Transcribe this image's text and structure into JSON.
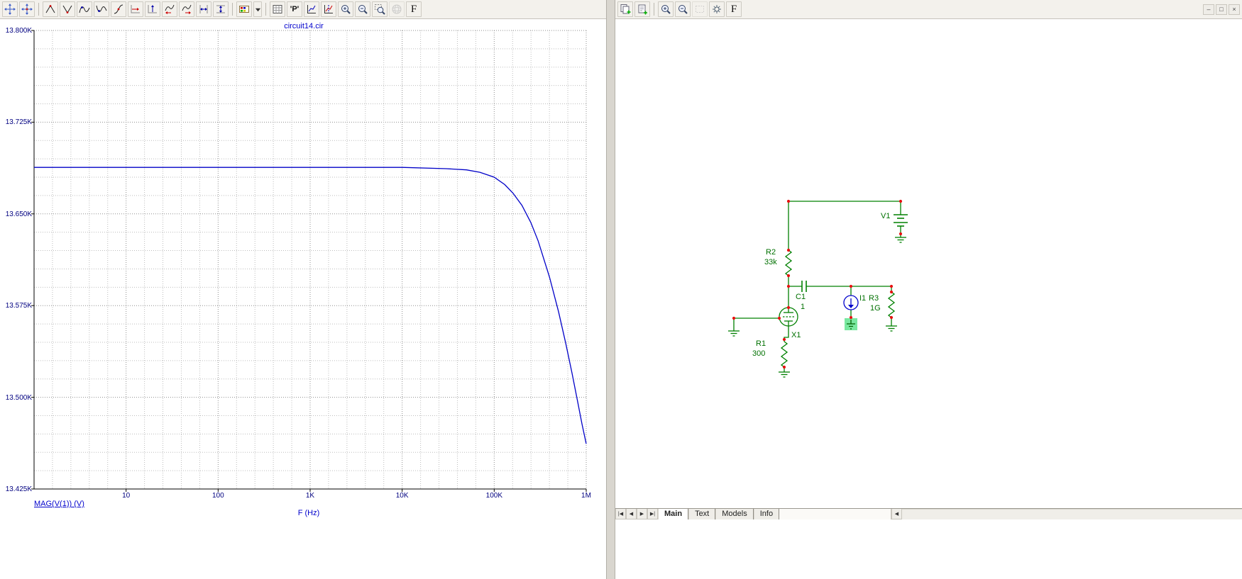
{
  "app": {
    "background": "#ffffff"
  },
  "chart_data": {
    "type": "line",
    "title": "circuit14.cir",
    "xlabel": "F (Hz)",
    "ylabel": "MAG(V(1)) (V)",
    "x_scale": "log",
    "xlim": [
      1,
      1000000
    ],
    "ylim": [
      13425,
      13800
    ],
    "ytick_values": [
      13800,
      13725,
      13650,
      13575,
      13500,
      13425
    ],
    "ytick_labels": [
      "13.800K",
      "13.725K",
      "13.650K",
      "13.575K",
      "13.500K",
      "13.425K"
    ],
    "xtick_values": [
      10,
      100,
      1000,
      10000,
      100000,
      1000000
    ],
    "xtick_labels": [
      "10",
      "100",
      "1K",
      "10K",
      "100K",
      "1M"
    ],
    "grid": "dotted",
    "legend_position": "bottom-left",
    "series": [
      {
        "name": "MAG(V(1))",
        "color": "#0000c8",
        "x": [
          1,
          10,
          100,
          1000,
          10000,
          30000,
          50000,
          70000,
          100000,
          130000,
          160000,
          200000,
          250000,
          300000,
          400000,
          500000,
          600000,
          700000,
          800000,
          900000,
          1000000
        ],
        "y": [
          13688,
          13688,
          13688,
          13688,
          13688,
          13687,
          13686,
          13684,
          13680,
          13674,
          13667,
          13657,
          13643,
          13628,
          13598,
          13570,
          13544,
          13520,
          13498,
          13478,
          13462
        ]
      }
    ]
  },
  "plot_panel": {
    "title": "circuit14.cir",
    "trace_label": "MAG(V(1)) (V)",
    "xaxis_label": "F (Hz)",
    "toolbar": {
      "p_label": "'P'",
      "font_label": "F"
    }
  },
  "schematic_panel": {
    "toolbar": {
      "font_label": "F"
    },
    "components": [
      {
        "id": "v1",
        "label": "V1",
        "value": ""
      },
      {
        "id": "r2",
        "label": "R2",
        "value": "33k"
      },
      {
        "id": "c1",
        "label": "C1",
        "value": "1"
      },
      {
        "id": "i1",
        "label": "I1",
        "value": ""
      },
      {
        "id": "r3",
        "label": "R3",
        "value": "1G"
      },
      {
        "id": "x1",
        "label": "X1",
        "value": ""
      },
      {
        "id": "r1",
        "label": "R1",
        "value": "300"
      }
    ],
    "tabs": [
      "Main",
      "Text",
      "Models",
      "Info"
    ],
    "active_tab": "Main",
    "tab_nav": [
      "|◀",
      "◀",
      "▶",
      "▶|"
    ],
    "hscroll_left": "◀",
    "colors": {
      "wire": "#008000",
      "node": "#e81010",
      "label": "#007000",
      "selection": "#79e8a0",
      "source": "#0000cc"
    }
  },
  "window_controls": {
    "minimize": "–",
    "restore": "□",
    "close": "×"
  }
}
